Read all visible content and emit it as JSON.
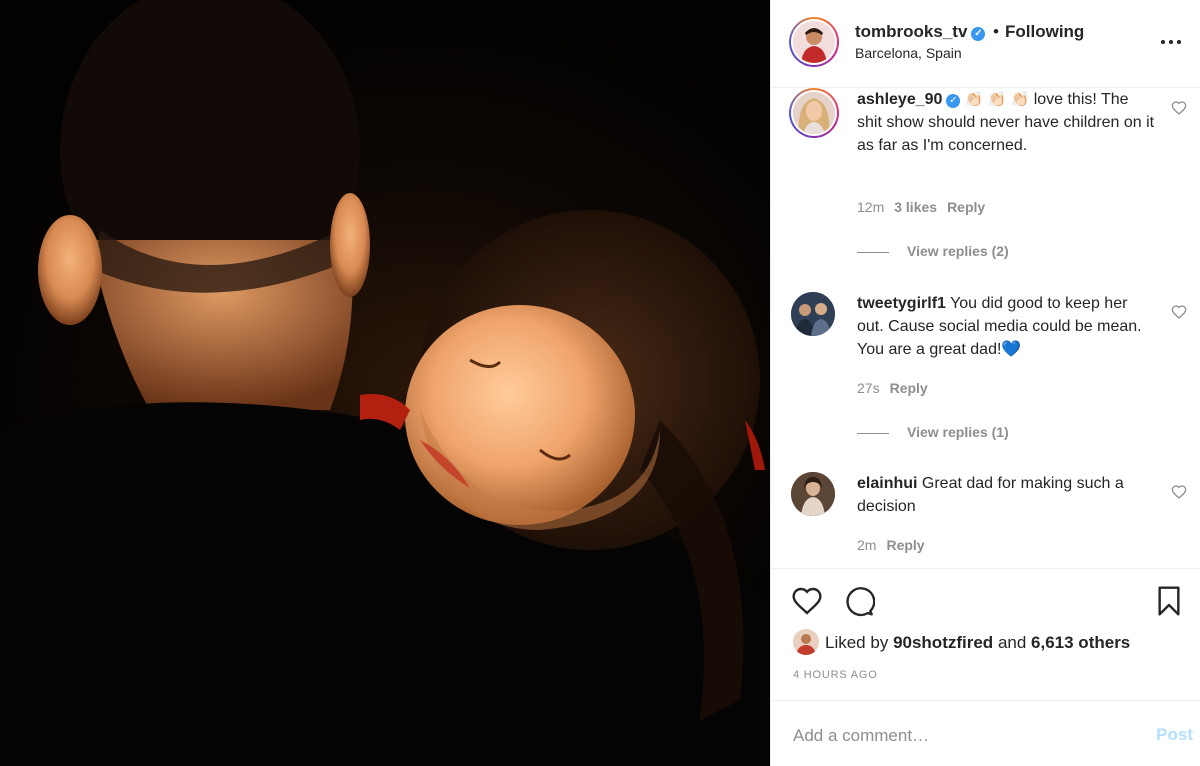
{
  "post": {
    "photo_alt": "",
    "header": {
      "username": "tombrooks_tv",
      "verified": true,
      "separator": "•",
      "follow_status": "Following",
      "location": "Barcelona, Spain"
    },
    "comments": [
      {
        "username": "ashleye_90",
        "verified": true,
        "emoji": "👏🏻 👏🏻 👏🏻",
        "text": "love this! The shit show should never have children on it as far as I'm concerned.",
        "time": "12m",
        "likes": "3 likes",
        "reply_label": "Reply",
        "view_replies": "View replies (2)"
      },
      {
        "username": "tweetygirlf1",
        "verified": false,
        "text": "You did good to keep her out. Cause social media could be mean. You are a great dad!💙",
        "time": "27s",
        "reply_label": "Reply",
        "view_replies": "View replies (1)"
      },
      {
        "username": "elainhui",
        "verified": false,
        "text": "Great dad for making such a decision",
        "time": "2m",
        "reply_label": "Reply"
      }
    ],
    "likes": {
      "prefix": "Liked by",
      "user": "90shotzfired",
      "connector": "and",
      "others": "6,613 others"
    },
    "time_ago": "4 HOURS AGO",
    "add_comment": {
      "placeholder": "Add a comment…",
      "post_label": "Post"
    },
    "colors": {
      "link": "#3897f0",
      "post_disabled": "#b2dffc",
      "muted": "#8e8e8e",
      "text": "#262626"
    }
  }
}
